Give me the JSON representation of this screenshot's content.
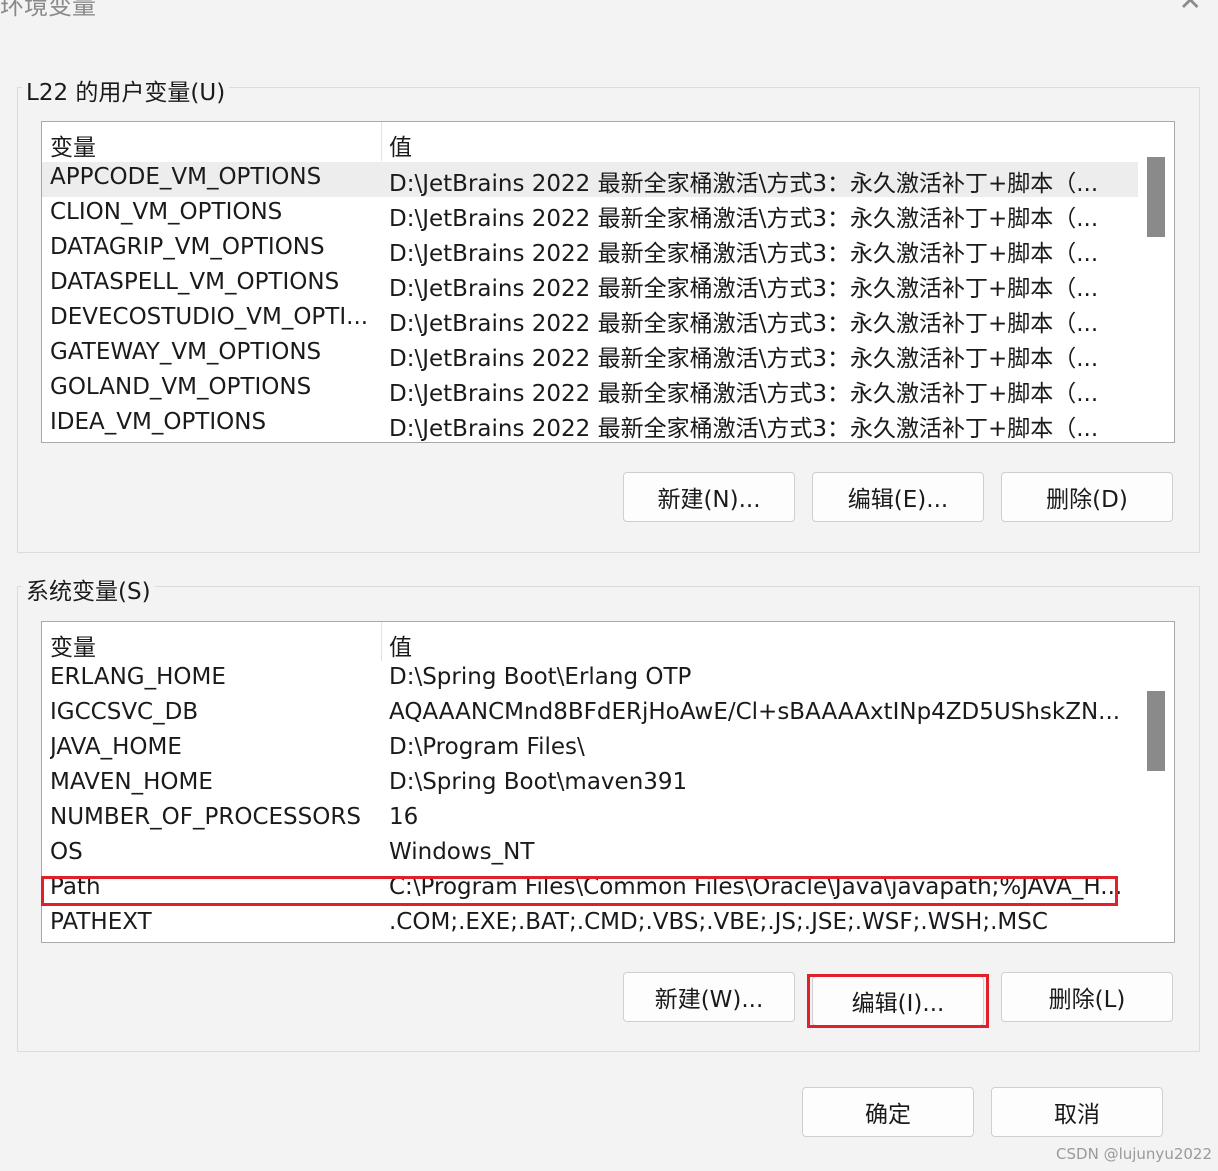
{
  "window": {
    "title": "环境变量",
    "close_glyph": "✕"
  },
  "user_vars": {
    "legend": "L22 的用户变量(U)",
    "header": {
      "name": "变量",
      "value": "值"
    },
    "rows": [
      {
        "name": "APPCODE_VM_OPTIONS",
        "value": "D:\\JetBrains  2022 最新全家桶激活\\方式3：永久激活补丁+脚本（..."
      },
      {
        "name": "CLION_VM_OPTIONS",
        "value": "D:\\JetBrains  2022 最新全家桶激活\\方式3：永久激活补丁+脚本（..."
      },
      {
        "name": "DATAGRIP_VM_OPTIONS",
        "value": "D:\\JetBrains  2022 最新全家桶激活\\方式3：永久激活补丁+脚本（..."
      },
      {
        "name": "DATASPELL_VM_OPTIONS",
        "value": "D:\\JetBrains  2022 最新全家桶激活\\方式3：永久激活补丁+脚本（..."
      },
      {
        "name": "DEVECOSTUDIO_VM_OPTI...",
        "value": "D:\\JetBrains  2022 最新全家桶激活\\方式3：永久激活补丁+脚本（..."
      },
      {
        "name": "GATEWAY_VM_OPTIONS",
        "value": "D:\\JetBrains  2022 最新全家桶激活\\方式3：永久激活补丁+脚本（..."
      },
      {
        "name": "GOLAND_VM_OPTIONS",
        "value": "D:\\JetBrains  2022 最新全家桶激活\\方式3：永久激活补丁+脚本（..."
      },
      {
        "name": "IDEA_VM_OPTIONS",
        "value": "D:\\JetBrains  2022 最新全家桶激活\\方式3：永久激活补丁+脚本（..."
      }
    ],
    "buttons": {
      "new": "新建(N)...",
      "edit": "编辑(E)...",
      "delete": "删除(D)"
    }
  },
  "system_vars": {
    "legend": "系统变量(S)",
    "header": {
      "name": "变量",
      "value": "值"
    },
    "rows": [
      {
        "name": "ERLANG_HOME",
        "value": "D:\\Spring Boot\\Erlang OTP"
      },
      {
        "name": "IGCCSVC_DB",
        "value": "AQAAANCMnd8BFdERjHoAwE/Cl+sBAAAAxtINp4ZD5UShskZN..."
      },
      {
        "name": "JAVA_HOME",
        "value": "D:\\Program Files\\"
      },
      {
        "name": "MAVEN_HOME",
        "value": "D:\\Spring Boot\\maven391"
      },
      {
        "name": "NUMBER_OF_PROCESSORS",
        "value": "16"
      },
      {
        "name": "OS",
        "value": "Windows_NT"
      },
      {
        "name": "Path",
        "value": "C:\\Program Files\\Common Files\\Oracle\\Java\\javapath;%JAVA_H..."
      },
      {
        "name": "PATHEXT",
        "value": ".COM;.EXE;.BAT;.CMD;.VBS;.VBE;.JS;.JSE;.WSF;.WSH;.MSC"
      }
    ],
    "buttons": {
      "new": "新建(W)...",
      "edit": "编辑(I)...",
      "delete": "删除(L)"
    }
  },
  "dialog_buttons": {
    "ok": "确定",
    "cancel": "取消"
  },
  "watermark": "CSDN @lujunyu2022",
  "colors": {
    "highlight": "#e0202a",
    "selected_row": "#ededed"
  }
}
